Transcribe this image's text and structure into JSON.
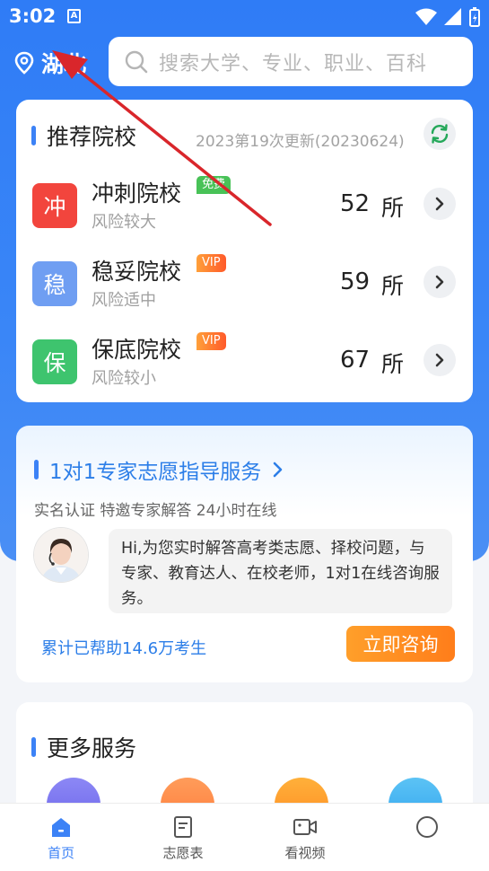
{
  "status_bar": {
    "time": "3:02",
    "app_badge": "A"
  },
  "header": {
    "location": "湖北",
    "search_placeholder": "搜索大学、专业、职业、百科"
  },
  "recommend": {
    "title": "推荐院校",
    "update_note": "2023第19次更新(20230624)",
    "rows": [
      {
        "badge": "冲",
        "badge_color": "#f2453d",
        "name": "冲刺院校",
        "tag": "免费",
        "tag_color": "#48c257",
        "risk": "风险较大",
        "count": "52",
        "unit": "所"
      },
      {
        "badge": "稳",
        "badge_color": "#6f9ef2",
        "name": "稳妥院校",
        "tag": "VIP",
        "tag_color": "#ff7a2e",
        "risk": "风险适中",
        "count": "59",
        "unit": "所"
      },
      {
        "badge": "保",
        "badge_color": "#3ec46e",
        "name": "保底院校",
        "tag": "VIP",
        "tag_color": "#ff7a2e",
        "risk": "风险较小",
        "count": "67",
        "unit": "所"
      }
    ]
  },
  "expert": {
    "title": "1对1专家志愿指导服务",
    "subtitle": "实名认证 特邀专家解答 24小时在线",
    "message": "Hi,为您实时解答高考类志愿、择校问题，与专家、教育达人、在校老师，1对1在线咨询服务。",
    "helped": "累计已帮助14.6万考生",
    "consult_label": "立即咨询"
  },
  "more": {
    "title": "更多服务"
  },
  "tabs": [
    {
      "label": "首页",
      "icon": "home-icon",
      "active": true
    },
    {
      "label": "志愿表",
      "icon": "form-icon",
      "active": false
    },
    {
      "label": "看视频",
      "icon": "video-icon",
      "active": false
    },
    {
      "label": "",
      "icon": "profile-icon",
      "active": false
    }
  ],
  "colors": {
    "primary": "#3c82f6",
    "orange": "#ff8a22",
    "annotation": "#d9262b"
  }
}
